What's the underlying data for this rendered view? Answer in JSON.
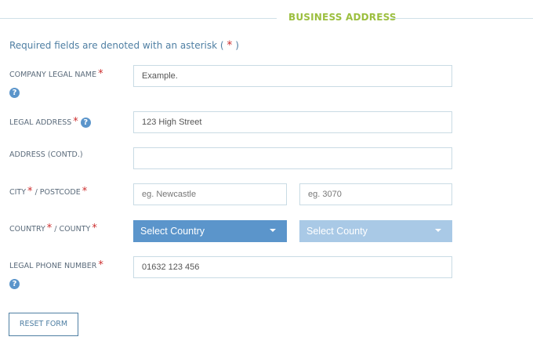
{
  "section": {
    "title": "BUSINESS ADDRESS"
  },
  "note": {
    "text_before": "Required fields are denoted with an asterisk ( ",
    "asterisk": "*",
    "text_after": " )"
  },
  "required_mark": "*",
  "help_glyph": "?",
  "fields": {
    "company_legal_name": {
      "label": "COMPANY LEGAL NAME",
      "value": "Example."
    },
    "legal_address": {
      "label": "LEGAL ADDRESS",
      "value": "123 High Street"
    },
    "address_contd": {
      "label": "ADDRESS (CONTD.)",
      "value": ""
    },
    "city_postcode": {
      "label_city": "CITY",
      "label_separator": " / ",
      "label_postcode": "POSTCODE",
      "city_placeholder": "eg. Newcastle",
      "postcode_placeholder": "eg. 3070"
    },
    "country_county": {
      "label_country": "COUNTRY",
      "label_separator": " / ",
      "label_county": "COUNTY",
      "country_value": "Select Country",
      "county_value": "Select County"
    },
    "legal_phone": {
      "label": "LEGAL PHONE NUMBER",
      "value": "01632 123 456"
    }
  },
  "buttons": {
    "reset": "RESET FORM"
  },
  "colors": {
    "accent": "#5b95cb",
    "title": "#9cbf3f",
    "required": "#cc2d2d",
    "disabled_select": "#a9c9e6"
  },
  "icons": {
    "help": "question-circle-icon",
    "dropdown": "caret-down-icon"
  }
}
